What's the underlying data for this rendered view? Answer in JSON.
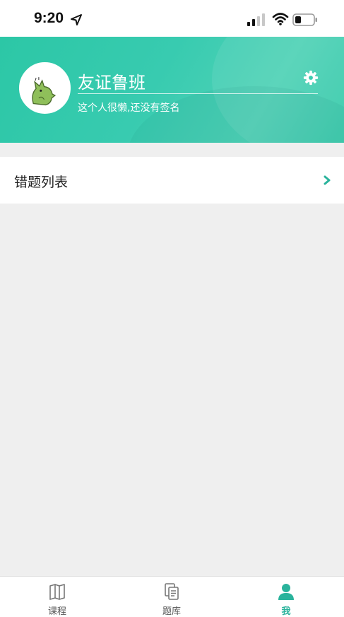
{
  "status_bar": {
    "time": "9:20"
  },
  "header": {
    "username": "友证鲁班",
    "signature": "这个人很懒,还没有签名",
    "avatar_icon": "dinosaur-avatar",
    "settings_icon": "gear-icon"
  },
  "list": {
    "items": [
      {
        "label": "错题列表",
        "icon": "chevron-right-icon"
      }
    ]
  },
  "bottom_nav": {
    "items": [
      {
        "label": "课程",
        "icon": "book-icon",
        "active": false
      },
      {
        "label": "题库",
        "icon": "documents-icon",
        "active": false
      },
      {
        "label": "我",
        "icon": "person-icon",
        "active": true
      }
    ]
  },
  "colors": {
    "accent": "#2ab39c",
    "header_start": "#2cc7a6",
    "header_end": "#4fd2b6",
    "background": "#efefef"
  }
}
